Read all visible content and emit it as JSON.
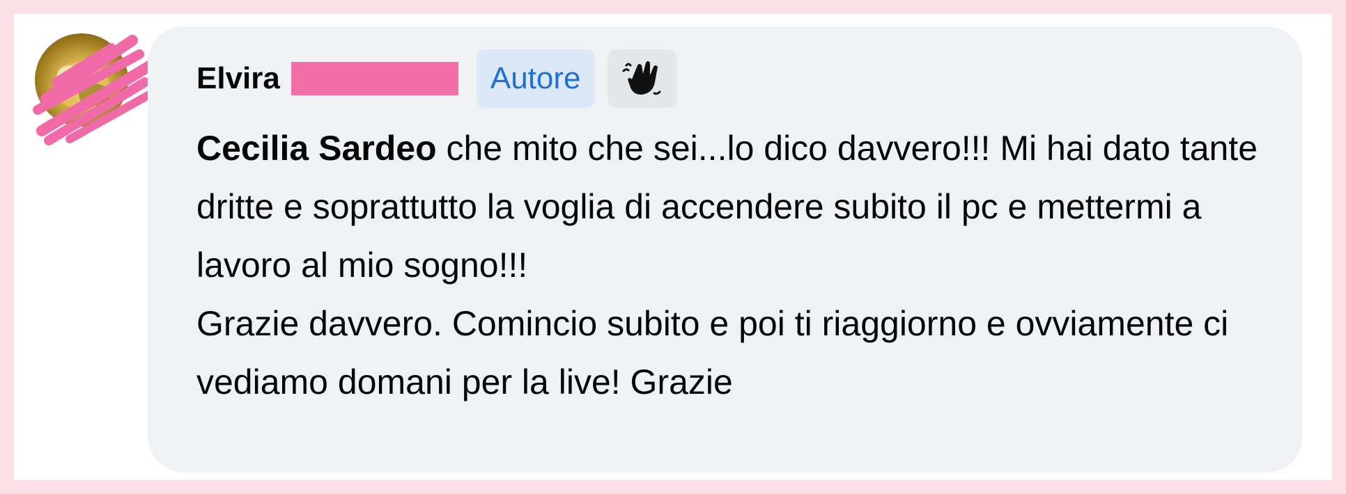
{
  "comment": {
    "author_name": "Elvira",
    "author_badge": "Autore",
    "mention": "Cecilia Sardeo",
    "text_after_mention": " che mito che sei...lo dico davvero!!! Mi hai dato tante dritte e soprattutto la voglia di accendere subito il pc e mettermi a lavoro al mio sogno!!!",
    "text_line2": "Grazie davvero. Comincio subito e poi ti riaggiorno e ovviamente ci vediamo domani per la live! Grazie"
  },
  "icons": {
    "wave": "waving-hand-icon",
    "avatar": "profile-avatar"
  },
  "colors": {
    "page_border": "#fde0e6",
    "bubble_bg": "#eff2f5",
    "badge_bg": "#dde8f7",
    "badge_text": "#1f6fd6",
    "redaction": "#f26ea8",
    "text": "#050505"
  }
}
